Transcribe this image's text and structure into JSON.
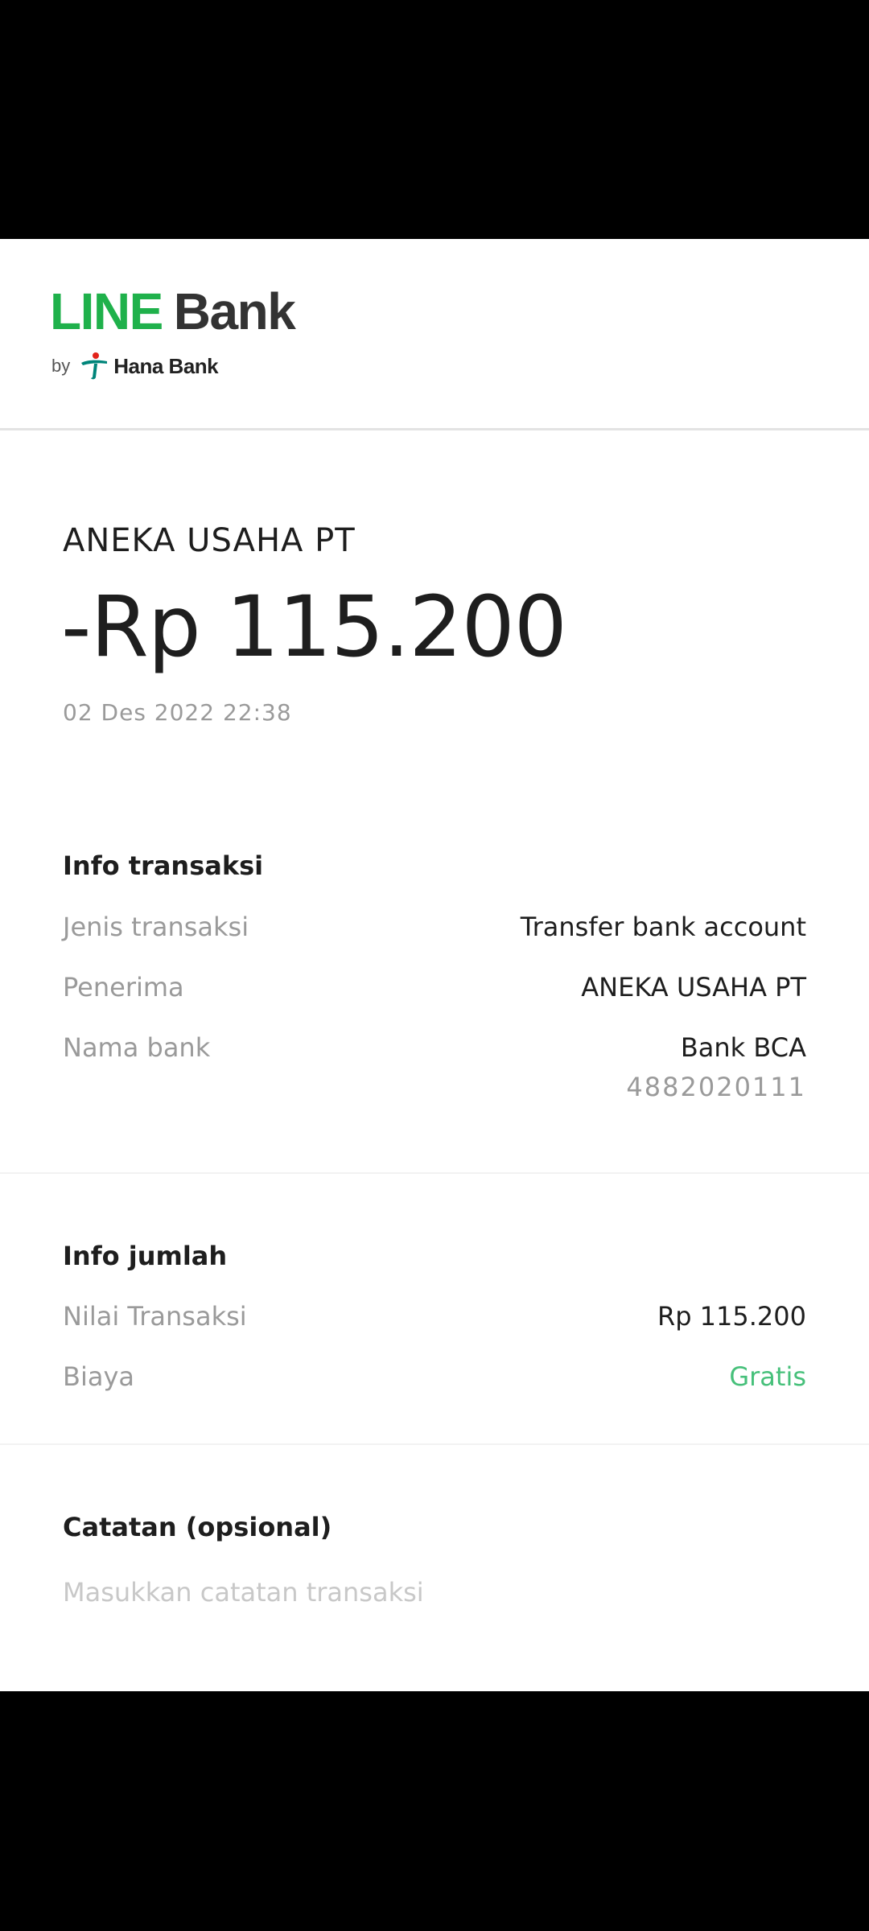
{
  "brand": {
    "line_text": "LINE",
    "bank_text": "Bank",
    "by_text": "by",
    "partner_text": "Hana Bank",
    "line_color": "#1fb14b",
    "partner_icon": "hana-bank-logo-icon"
  },
  "summary": {
    "merchant": "ANEKA USAHA PT",
    "amount": "-Rp 115.200",
    "datetime": "02 Des 2022 22:38"
  },
  "transaction_info": {
    "title": "Info transaksi",
    "rows": [
      {
        "label": "Jenis transaksi",
        "value": "Transfer bank account"
      },
      {
        "label": "Penerima",
        "value": "ANEKA USAHA PT"
      },
      {
        "label": "Nama bank",
        "value": "Bank BCA",
        "sub_value": "4882020111"
      }
    ]
  },
  "amount_info": {
    "title": "Info jumlah",
    "rows": [
      {
        "label": "Nilai Transaksi",
        "value": "Rp 115.200"
      },
      {
        "label": "Biaya",
        "value": "Gratis",
        "value_color": "#46c07a"
      }
    ]
  },
  "notes": {
    "title": "Catatan (opsional)",
    "placeholder": "Masukkan catatan transaksi",
    "value": ""
  }
}
